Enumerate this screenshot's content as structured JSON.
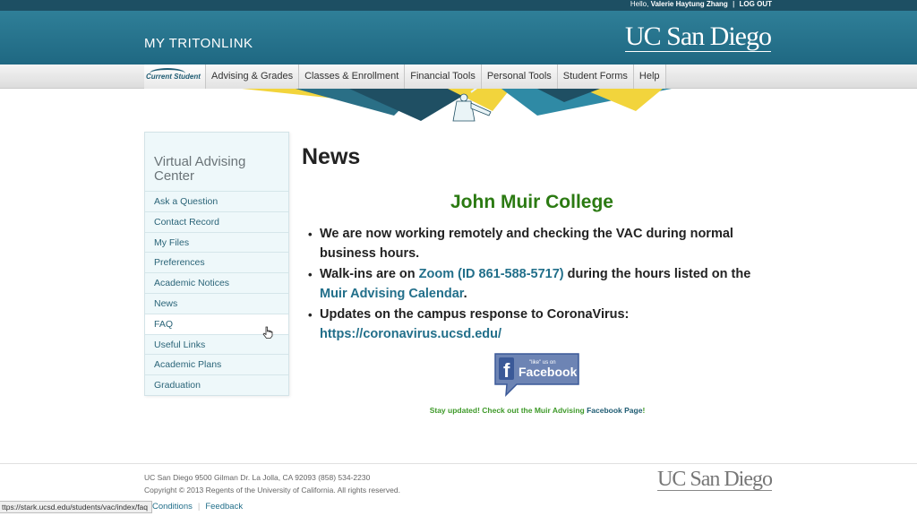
{
  "topbar": {
    "greeting": "Hello,",
    "user_name": "Valerie Haytung Zhang",
    "separator": "|",
    "logout_label": "LOG OUT"
  },
  "header": {
    "brand": "MY TRITONLINK",
    "logo_text": "UC San Diego"
  },
  "nav": {
    "current_student_label": "Current Student",
    "items": [
      "Advising & Grades",
      "Classes & Enrollment",
      "Financial Tools",
      "Personal Tools",
      "Student Forms",
      "Help"
    ]
  },
  "sidebar": {
    "title": "Virtual Advising Center",
    "items": [
      "Ask a Question",
      "Contact Record",
      "My Files",
      "Preferences",
      "Academic Notices",
      "News",
      "FAQ",
      "Useful Links",
      "Academic Plans",
      "Graduation"
    ]
  },
  "main": {
    "page_title": "News",
    "college_heading": "John Muir College",
    "bullet1": "We are now working remotely and checking the VAC during normal business hours.",
    "bullet2_pre": "Walk-ins are on ",
    "bullet2_link1": "Zoom (ID 861-588-5717)",
    "bullet2_mid": " during the hours listed on the ",
    "bullet2_link2": "Muir Advising Calendar",
    "bullet2_post": ".",
    "bullet3_pre": "Updates on the campus response to CoronaVirus: ",
    "bullet3_link": "https://coronavirus.ucsd.edu/",
    "fb_small": "\"like\" us on",
    "fb_word": "Facebook",
    "stay_text": "Stay updated! Check out the Muir Advising ",
    "stay_link": "Facebook Page",
    "stay_end": "!"
  },
  "footer": {
    "address": "UC San Diego 9500 Gilman Dr. La Jolla, CA 92093 (858) 534-2230",
    "copyright": "Copyright © 2013 Regents of the University of California. All rights reserved.",
    "terms_label": "& Conditions",
    "feedback_label": "Feedback",
    "logo_text": "UC San Diego"
  },
  "status_url": "ttps://stark.ucsd.edu/students/vac/index/faq",
  "colors": {
    "header": "#2f7f98",
    "topbar": "#1d4f63",
    "link": "#226f8a",
    "college_green": "#2b7a12",
    "facebook_blue": "#3b5998"
  }
}
